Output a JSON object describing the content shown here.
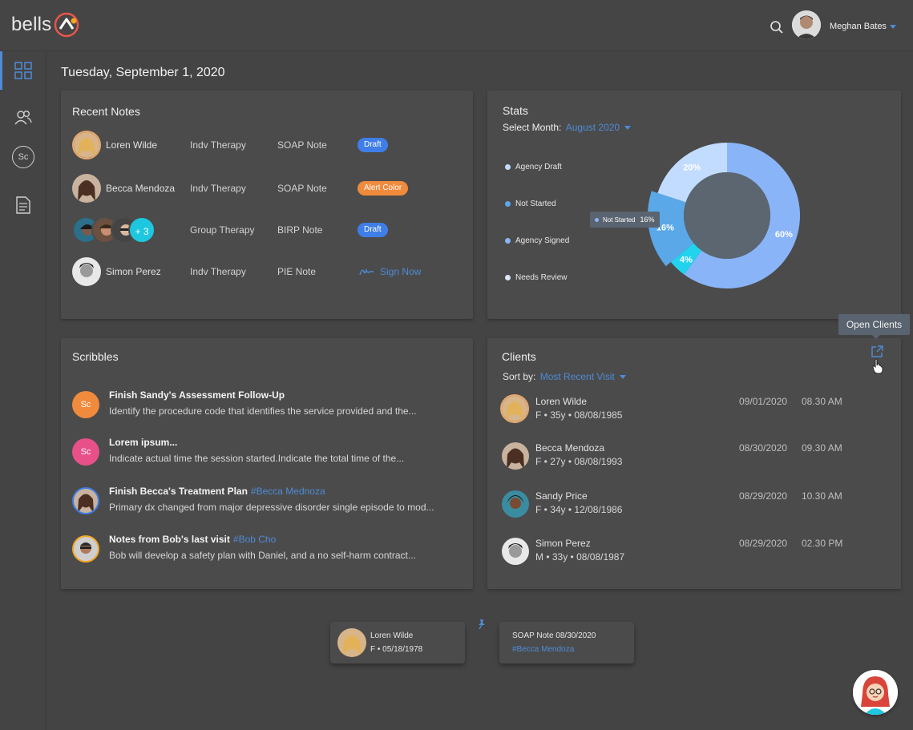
{
  "app": {
    "logo_text": "bells"
  },
  "header": {
    "user_name": "Meghan Bates"
  },
  "date": "Tuesday, September 1, 2020",
  "recent_notes": {
    "title": "Recent Notes",
    "rows": [
      {
        "name": "Loren Wilde",
        "type": "Indv Therapy",
        "note": "SOAP Note",
        "status": "Draft"
      },
      {
        "name": "Becca Mendoza",
        "type": "Indv Therapy",
        "note": "SOAP Note",
        "status": "Alert Color"
      },
      {
        "name": "",
        "extra": "+ 3",
        "type": "Group Therapy",
        "note": "BIRP Note",
        "status": "Draft"
      },
      {
        "name": "Simon Perez",
        "type": "Indv Therapy",
        "note": "PIE Note",
        "status": "Sign Now"
      }
    ]
  },
  "stats": {
    "title": "Stats",
    "select_label": "Select Month:",
    "month": "August 2020",
    "legend": [
      "Agency Draft",
      "Not Started",
      "Agency Signed",
      "Needs Review"
    ],
    "tooltip_label": "Not Started",
    "tooltip_value": "16%",
    "colors": {
      "agency_draft": "#c2dcff",
      "not_started": "#5aa8e8",
      "agency_signed": "#8ab4f8",
      "needs_review": "#22d3ee"
    }
  },
  "chart_data": {
    "type": "pie",
    "categories": [
      "Agency Signed",
      "Needs Review",
      "Not Started",
      "Agency Draft"
    ],
    "values": [
      60,
      4,
      16,
      20
    ],
    "labels": [
      "60%",
      "4%",
      "16%",
      "20%"
    ]
  },
  "scribbles": {
    "title": "Scribbles",
    "items": [
      {
        "initials": "Sc",
        "title": "Finish Sandy's Assessment Follow-Up",
        "tag": "",
        "body": "Identify the procedure code that identifies the service provided and the..."
      },
      {
        "initials": "Sc",
        "title": "Lorem ipsum...",
        "tag": "",
        "body": "Indicate actual time the session started.Indicate the total time of the..."
      },
      {
        "initials": "",
        "title": "Finish Becca's Treatment Plan",
        "tag": "#Becca Mednoza",
        "body": "Primary dx changed from major depressive disorder single episode to mod..."
      },
      {
        "initials": "",
        "title": "Notes from Bob's last visit",
        "tag": "#Bob Cho",
        "body": "Bob will develop a safety plan with Daniel, and a no self-harm contract..."
      }
    ]
  },
  "clients": {
    "title": "Clients",
    "sort_label": "Sort by:",
    "sort_value": "Most Recent Visit",
    "open_tooltip": "Open Clients",
    "rows": [
      {
        "name": "Loren Wilde",
        "meta": "F • 35y • 08/08/1985",
        "date": "09/01/2020",
        "time": "08.30 AM"
      },
      {
        "name": "Becca Mendoza",
        "meta": "F • 27y • 08/08/1993",
        "date": "08/30/2020",
        "time": "09.30 AM"
      },
      {
        "name": "Sandy Price",
        "meta": "F • 34y • 12/08/1986",
        "date": "08/29/2020",
        "time": "10.30 AM"
      },
      {
        "name": "Simon Perez",
        "meta": "M • 33y • 08/08/1987",
        "date": "08/29/2020",
        "time": "02.30 PM"
      }
    ]
  },
  "pinned": {
    "client_name": "Loren Wilde",
    "client_meta": "F • 05/18/1978",
    "note_title": "SOAP Note  08/30/2020",
    "note_tag": "#Becca Mendoza"
  },
  "sidebar": {
    "items": [
      "dashboard",
      "clients",
      "Sc",
      "notes"
    ]
  }
}
